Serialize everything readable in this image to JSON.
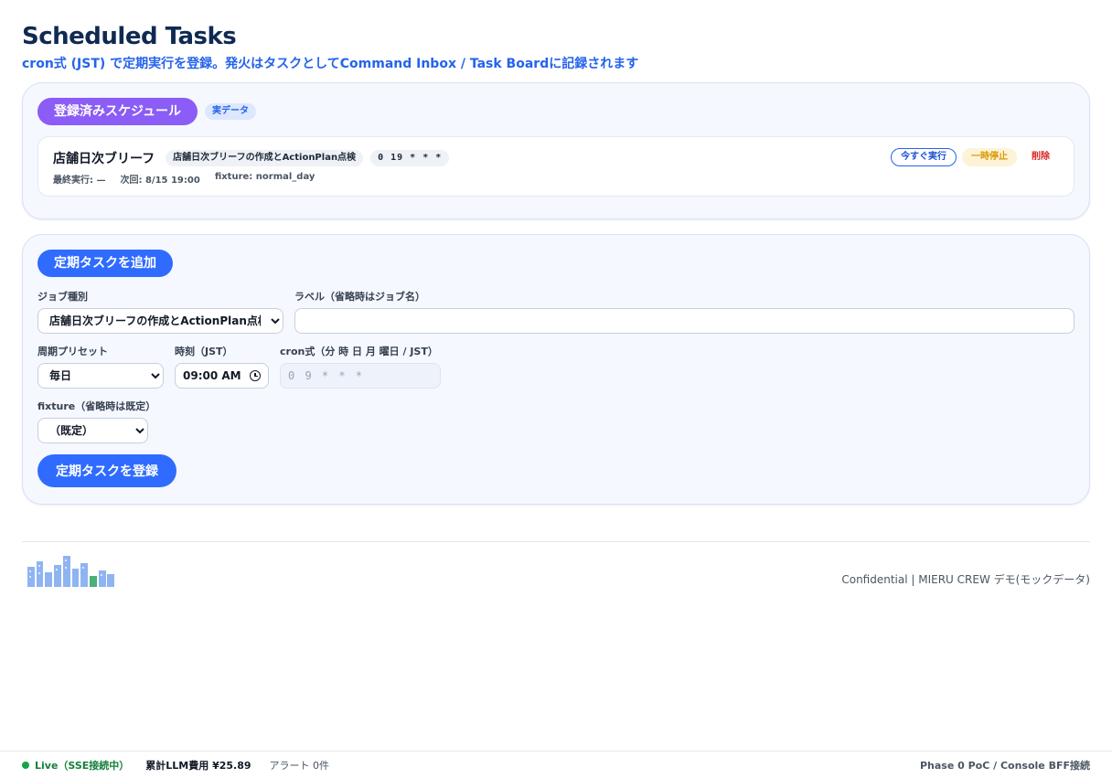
{
  "header": {
    "title": "Scheduled Tasks",
    "subtitle": "cron式 (JST) で定期実行を登録。発火はタスクとしてCommand Inbox / Task Boardに記録されます"
  },
  "schedules": {
    "heading": "登録済みスケジュール",
    "badge": "実データ",
    "items": [
      {
        "name": "店舗日次ブリーフ",
        "job_chip": "店舗日次ブリーフの作成とActionPlan点検",
        "cron_chip": "0 19 * * *",
        "last_run": "最終実行: —",
        "next_run": "次回: 8/15 19:00",
        "fixture": "fixture: normal_day",
        "run_now_label": "今すぐ実行",
        "pause_label": "一時停止",
        "delete_label": "削除"
      }
    ]
  },
  "add_form": {
    "heading": "定期タスクを追加",
    "job_type_label": "ジョブ種別",
    "job_type_value": "店舗日次ブリーフの作成とActionPlan点検",
    "label_field_label": "ラベル（省略時はジョブ名）",
    "label_field_value": "",
    "preset_label": "周期プリセット",
    "preset_value": "毎日",
    "time_label": "時刻（JST）",
    "time_value": "09:00 AM",
    "cron_label": "cron式（分 時 日 月 曜日 / JST）",
    "cron_value": "0 9 * * *",
    "fixture_label": "fixture（省略時は既定）",
    "fixture_value": "（既定）",
    "submit_label": "定期タスクを登録"
  },
  "footer": {
    "text": "Confidential | MIERU CREW デモ(モックデータ)"
  },
  "status_bar": {
    "live": "Live（SSE接続中）",
    "cost": "累計LLM費用 ¥25.89",
    "alerts": "アラート 0件",
    "phase": "Phase 0 PoC / Console BFF接続"
  },
  "colors": {
    "title": "#0f2a52",
    "accent_blue": "#2f6bff",
    "accent_purple": "#8b5cf6",
    "live_green": "#16a34a",
    "delete_red": "#dc2626",
    "pause_amber": "#d99a06"
  },
  "icons": [
    "clock-icon",
    "city-skyline-logo",
    "live-status-dot"
  ]
}
